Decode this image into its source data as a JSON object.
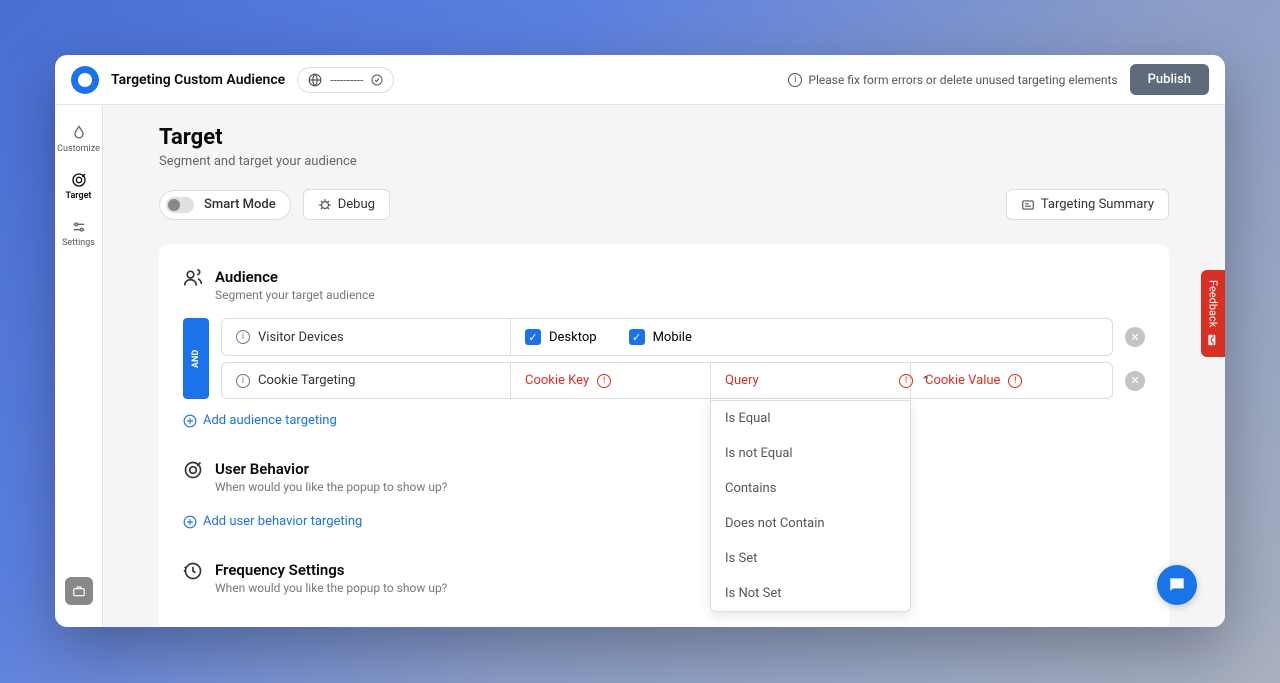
{
  "topbar": {
    "title": "Targeting Custom Audience",
    "pill_text": "----------",
    "error_msg": "Please fix form errors or delete unused targeting elements",
    "publish": "Publish"
  },
  "sidebar": {
    "items": [
      {
        "label": "Customize"
      },
      {
        "label": "Target"
      },
      {
        "label": "Settings"
      }
    ]
  },
  "page": {
    "title": "Target",
    "subtitle": "Segment and target your audience"
  },
  "controls": {
    "smart_mode": "Smart Mode",
    "debug": "Debug",
    "summary": "Targeting Summary"
  },
  "audience": {
    "title": "Audience",
    "subtitle": "Segment your target audience",
    "and": "AND",
    "rule1": {
      "label": "Visitor Devices",
      "opt1": "Desktop",
      "opt2": "Mobile"
    },
    "rule2": {
      "label": "Cookie Targeting",
      "key": "Cookie Key",
      "query": "Query",
      "value": "Cookie Value"
    },
    "dropdown": [
      "Is Equal",
      "Is not Equal",
      "Contains",
      "Does not Contain",
      "Is Set",
      "Is Not Set"
    ],
    "add": "Add audience targeting"
  },
  "behavior": {
    "title": "User Behavior",
    "subtitle": "When would you like the popup to show up?",
    "add": "Add user behavior targeting"
  },
  "frequency": {
    "title": "Frequency Settings",
    "subtitle": "When would you like the popup to show up?"
  },
  "feedback": "Feedback"
}
